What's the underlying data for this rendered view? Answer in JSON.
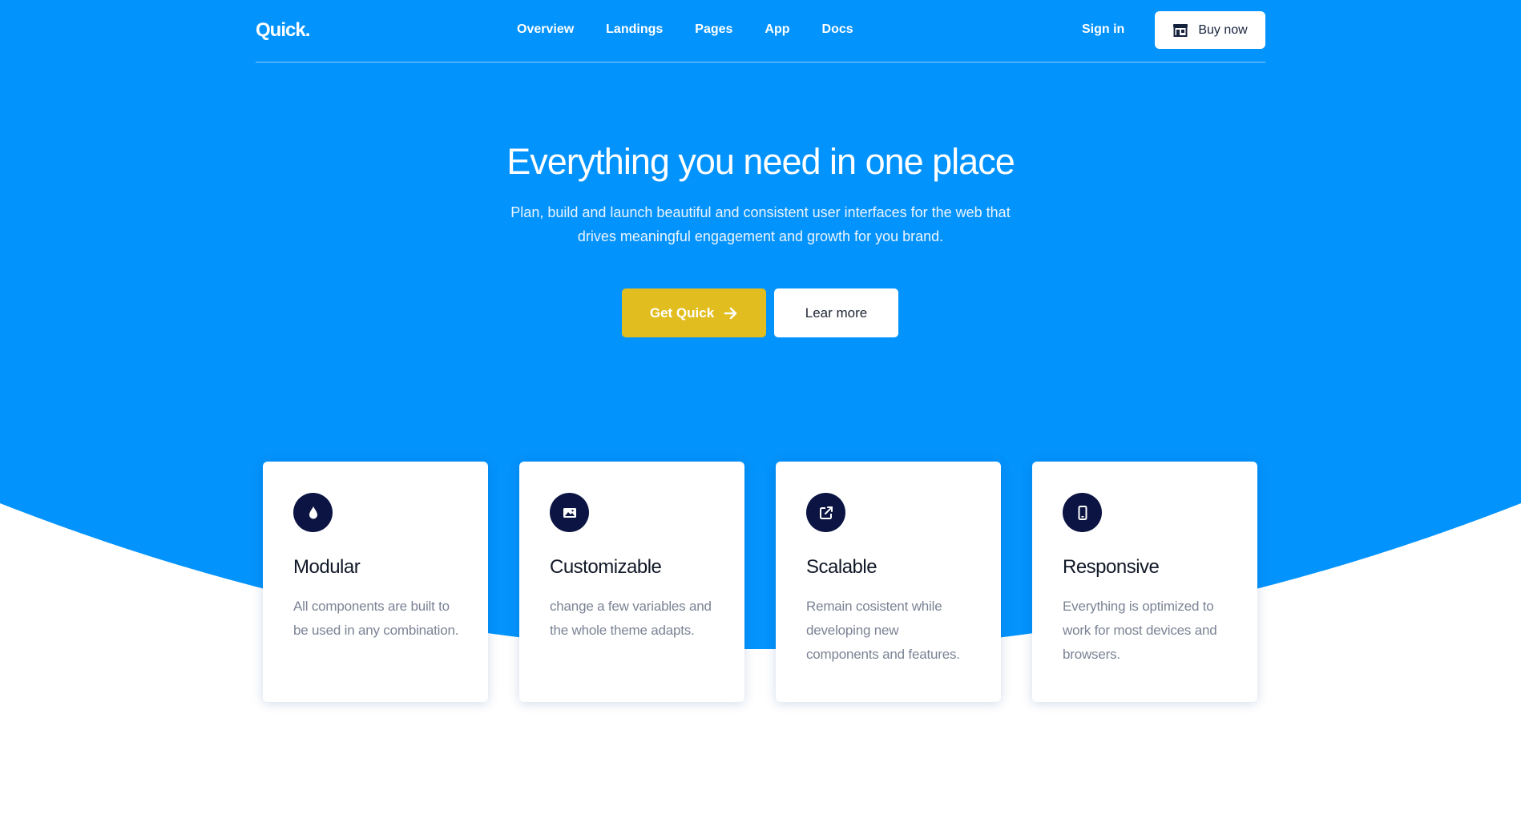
{
  "colors": {
    "hero_bg": "#0393fc",
    "accent_button": "#e2bd1f",
    "icon_circle": "#0b1442",
    "white": "#ffffff"
  },
  "header": {
    "logo": "Quick.",
    "nav": [
      "Overview",
      "Landings",
      "Pages",
      "App",
      "Docs"
    ],
    "sign_in": "Sign in",
    "buy_now": "Buy now",
    "buy_icon": "store-icon"
  },
  "hero": {
    "title": "Everything you need in one place",
    "subtitle": "Plan, build and launch beautiful and consistent user interfaces for the web that drives meaningful engagement and growth for you brand.",
    "primary_cta": "Get Quick",
    "primary_cta_icon": "arrow-right-icon",
    "secondary_cta": "Lear more"
  },
  "features": [
    {
      "icon": "droplet-icon",
      "title": "Modular",
      "text": "All components are built to be used in any combination."
    },
    {
      "icon": "image-icon",
      "title": "Customizable",
      "text": "change a few variables and the whole theme adapts."
    },
    {
      "icon": "external-link-icon",
      "title": "Scalable",
      "text": "Remain cosistent while developing new components and features."
    },
    {
      "icon": "mobile-icon",
      "title": "Responsive",
      "text": "Everything is optimized to work for most devices and browsers."
    }
  ]
}
